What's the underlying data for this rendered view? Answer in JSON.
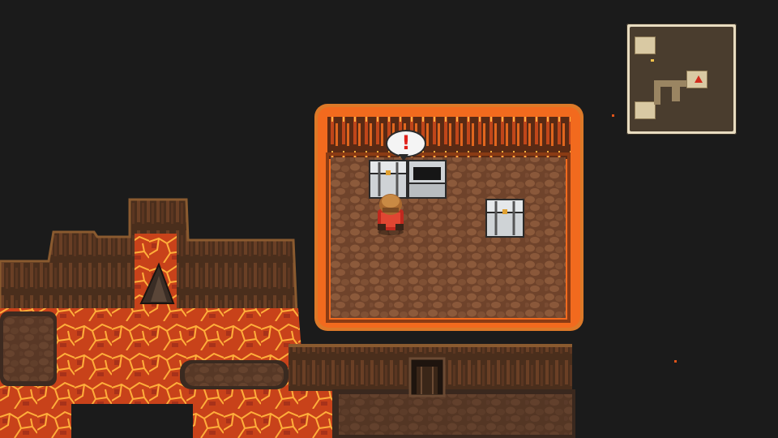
{
  "game": {
    "scene": "lava-cave-treasure-room",
    "player": {
      "state": "surprised",
      "emote": "!"
    },
    "chests": [
      {
        "state": "closed"
      },
      {
        "state": "opened"
      },
      {
        "state": "closed"
      }
    ],
    "minimap": {
      "player_marker": "red-triangle"
    }
  },
  "colors": {
    "background": "#1b1b1b",
    "lava": "#e0541a",
    "lava_crack": "#ffb23a",
    "rock_floor": "#7a4a30",
    "cave_wall": "#3b2a1d",
    "minimap_frame": "#e8dcc0"
  }
}
